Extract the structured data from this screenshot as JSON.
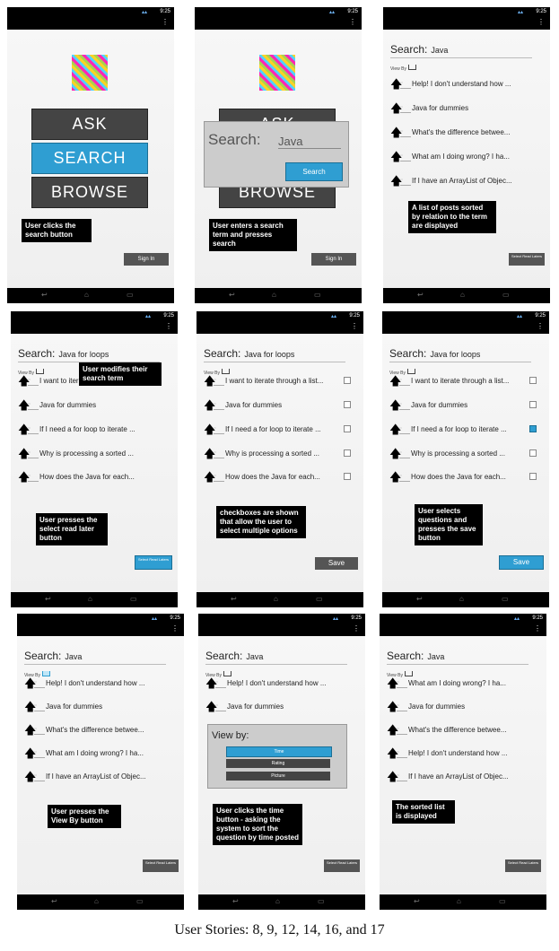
{
  "common": {
    "time": "9:25",
    "sign_in": "Sign In",
    "search_label": "Search:",
    "view_by": "View By",
    "select_read_later": "Select Read Laters",
    "save": "Save"
  },
  "panels": {
    "p1": {
      "buttons": [
        "ASK",
        "SEARCH",
        "BROWSE"
      ],
      "caption": "User clicks the search button"
    },
    "p2": {
      "dialog_label": "Search:",
      "dialog_value": "Java",
      "dialog_button": "Search",
      "under_top": "ASK",
      "under_bottom": "BROWSE",
      "caption": "User enters a search term and presses search"
    },
    "p3": {
      "term": "Java",
      "items": [
        "Help! I don't understand how ...",
        "Java for dummies",
        "What's the difference betwee...",
        "What am I doing wrong? I ha...",
        "If I have an ArrayList of Objec..."
      ],
      "caption": "A list of posts sorted by relation to the term are displayed"
    },
    "p4": {
      "term": "Java for loops",
      "items": [
        "I want to iterate through a list...",
        "Java for dummies",
        "If I need a for loop to iterate ...",
        "Why is processing a sorted ...",
        "How does the Java for each..."
      ],
      "caption_top": "User modifies their search term",
      "caption_bottom": "User presses the select read later button"
    },
    "p5": {
      "term": "Java for loops",
      "items": [
        "I want to iterate through a list...",
        "Java for dummies",
        "If I need a for loop to iterate ...",
        "Why is processing a sorted ...",
        "How does the Java for each..."
      ],
      "caption": "checkboxes are shown that allow the user to select multiple options"
    },
    "p6": {
      "term": "Java for loops",
      "items": [
        "I want to iterate through a list...",
        "Java for dummies",
        "If I need a for loop to iterate ...",
        "Why is processing a sorted ...",
        "How does the Java for each..."
      ],
      "caption": "User selects questions and presses the save button"
    },
    "p7": {
      "term": "Java",
      "items": [
        "Help! I don't understand how ...",
        "Java for dummies",
        "What's the difference betwee...",
        "What am I doing wrong? I ha...",
        "If I have an ArrayList of Objec..."
      ],
      "caption": "User presses the View By button"
    },
    "p8": {
      "term": "Java",
      "items": [
        "Help! I don't understand how ...",
        "Java for dummies"
      ],
      "dialog_title": "View by:",
      "options": [
        "Time",
        "Rating",
        "Picture"
      ],
      "caption": "User clicks the time button - asking the system to sort the question by time posted"
    },
    "p9": {
      "term": "Java",
      "items": [
        "What am I doing wrong? I ha...",
        "Java for dummies",
        "What's the difference betwee...",
        "Help! I don't understand how ...",
        "If I have an ArrayList of Objec..."
      ],
      "caption": "The sorted list is displayed"
    }
  },
  "footer": "User Stories: 8, 9, 12, 14, 16, and 17"
}
